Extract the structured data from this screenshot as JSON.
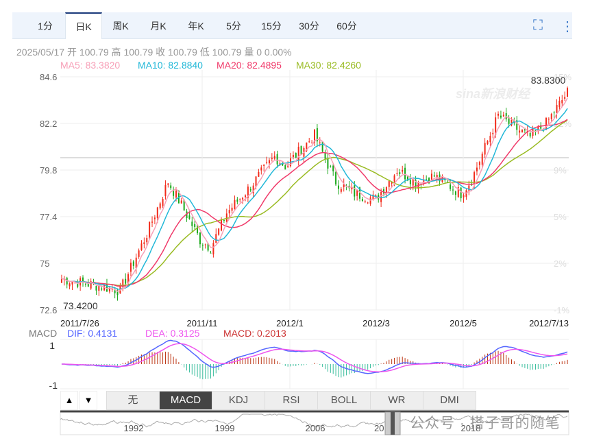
{
  "tabs": [
    "1分",
    "日K",
    "周K",
    "月K",
    "年K",
    "5分",
    "15分",
    "30分",
    "60分"
  ],
  "active_tab": 1,
  "info": "2025/05/17 开 100.79 高 100.79 收 100.79 低 100.79 量 0 0.00%",
  "ma": {
    "ma5": "MA5: 83.3820",
    "ma10": "MA10: 82.8840",
    "ma20": "MA20: 82.4895",
    "ma30": "MA30: 82.4260"
  },
  "colors": {
    "up": "#f22a1a",
    "down": "#1aa81a",
    "ma5": "#f7a0b8",
    "ma10": "#22b8d8",
    "ma20": "#f03a6a",
    "ma30": "#99bb22",
    "dif": "#5566ff",
    "dea": "#ee55ee",
    "macd_up": "#bb3311",
    "macd_down": "#33bb99"
  },
  "macd_label": {
    "name": "MACD",
    "dif": "DIF: 0.4131",
    "dea": "DEA: 0.3125",
    "macd": "MACD: 0.2013"
  },
  "indicators": [
    "无",
    "MACD",
    "KDJ",
    "RSI",
    "BOLL",
    "WR",
    "DMI"
  ],
  "active_indicator": 1,
  "arrows": [
    "▲",
    "▼"
  ],
  "minimap_years": [
    "1992",
    "1999",
    "2006",
    "2011",
    "2018"
  ],
  "watermark": "公众号 · 搭子哥的随笔",
  "chart_data": {
    "type": "candlestick",
    "y_ticks": [
      "84.6",
      "82.2",
      "79.8",
      "77.4",
      "75",
      "72.6"
    ],
    "ylim": [
      72.6,
      84.6
    ],
    "pct_ticks": [
      "15%",
      "12%",
      "9%",
      "5%",
      "2%",
      "-1%"
    ],
    "x_ticks": [
      "2011/7/26",
      "2011/11",
      "2012/1",
      "2012/3",
      "2012/5",
      "2012/7/13"
    ],
    "max_label": "83.8300",
    "min_label": "73.4200",
    "macd_ticks": [
      "1",
      "-1"
    ],
    "close_path": [
      [
        0,
        74.2
      ],
      [
        15,
        73.8
      ],
      [
        22,
        73.6
      ],
      [
        32,
        76.5
      ],
      [
        40,
        79.2
      ],
      [
        45,
        78.0
      ],
      [
        52,
        76.2
      ],
      [
        56,
        75.8
      ],
      [
        62,
        77.6
      ],
      [
        70,
        78.8
      ],
      [
        80,
        80.5
      ],
      [
        84,
        80.0
      ],
      [
        95,
        81.6
      ],
      [
        103,
        79.2
      ],
      [
        110,
        78.6
      ],
      [
        118,
        78.3
      ],
      [
        126,
        79.8
      ],
      [
        133,
        79.2
      ],
      [
        140,
        79.5
      ],
      [
        150,
        78.6
      ],
      [
        154,
        79.3
      ],
      [
        164,
        82.6
      ],
      [
        170,
        82.0
      ],
      [
        176,
        81.5
      ],
      [
        182,
        82.2
      ],
      [
        190,
        83.8
      ]
    ]
  }
}
